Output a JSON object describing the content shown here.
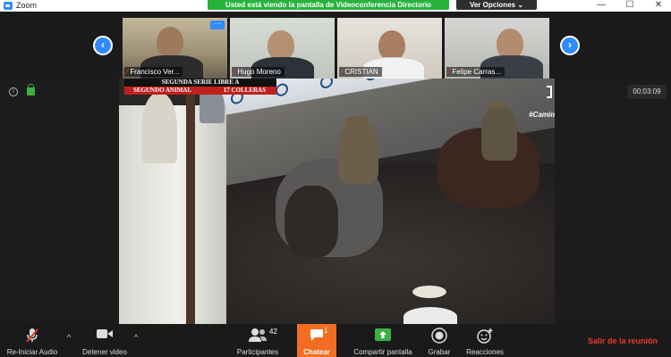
{
  "window": {
    "app_title": "Zoom",
    "share_banner": "Usted está viendo la pantalla de Videoconferencia Directorio",
    "view_options": "Ver Opciones",
    "view_options_caret": "⌄",
    "minimize_glyph": "—",
    "maximize_glyph": "☐",
    "close_glyph": "✕"
  },
  "gallery": {
    "prev_glyph": "‹",
    "next_glyph": "›",
    "more_glyph": "···",
    "mic_off_glyph": "⁄",
    "participants": [
      {
        "name": "Francisco Ver...",
        "muted": true
      },
      {
        "name": "Hugo Moreno",
        "muted": true
      },
      {
        "name": "CRISTIAN",
        "muted": true
      },
      {
        "name": "Felipe Carras...",
        "muted": true
      }
    ]
  },
  "meeting": {
    "info_glyph": "i",
    "elapsed": "00:03:09"
  },
  "shared_video": {
    "scoreboard_line1": "SEGUNDA SERIE LIBRE A",
    "scoreboard_left": "SEGUNDO ANIMAL",
    "scoreboard_right": "17 COLLERAS",
    "channel_tag": "#Camin"
  },
  "toolbar": {
    "audio_label": "Re-Iniciar Audio",
    "video_label": "Detener video",
    "caret_glyph": "^",
    "participants_label": "Participantes",
    "participants_count": "42",
    "chat_label": "Chatear",
    "chat_badge": "1",
    "share_label": "Compartir pantalla",
    "record_label": "Grabar",
    "reactions_label": "Reacciones",
    "leave_label": "Salir de la reunión"
  },
  "colors": {
    "zoom_blue": "#2d8cff",
    "share_green": "#27b33b",
    "chat_orange": "#f26d21",
    "leave_red": "#e8392f"
  }
}
